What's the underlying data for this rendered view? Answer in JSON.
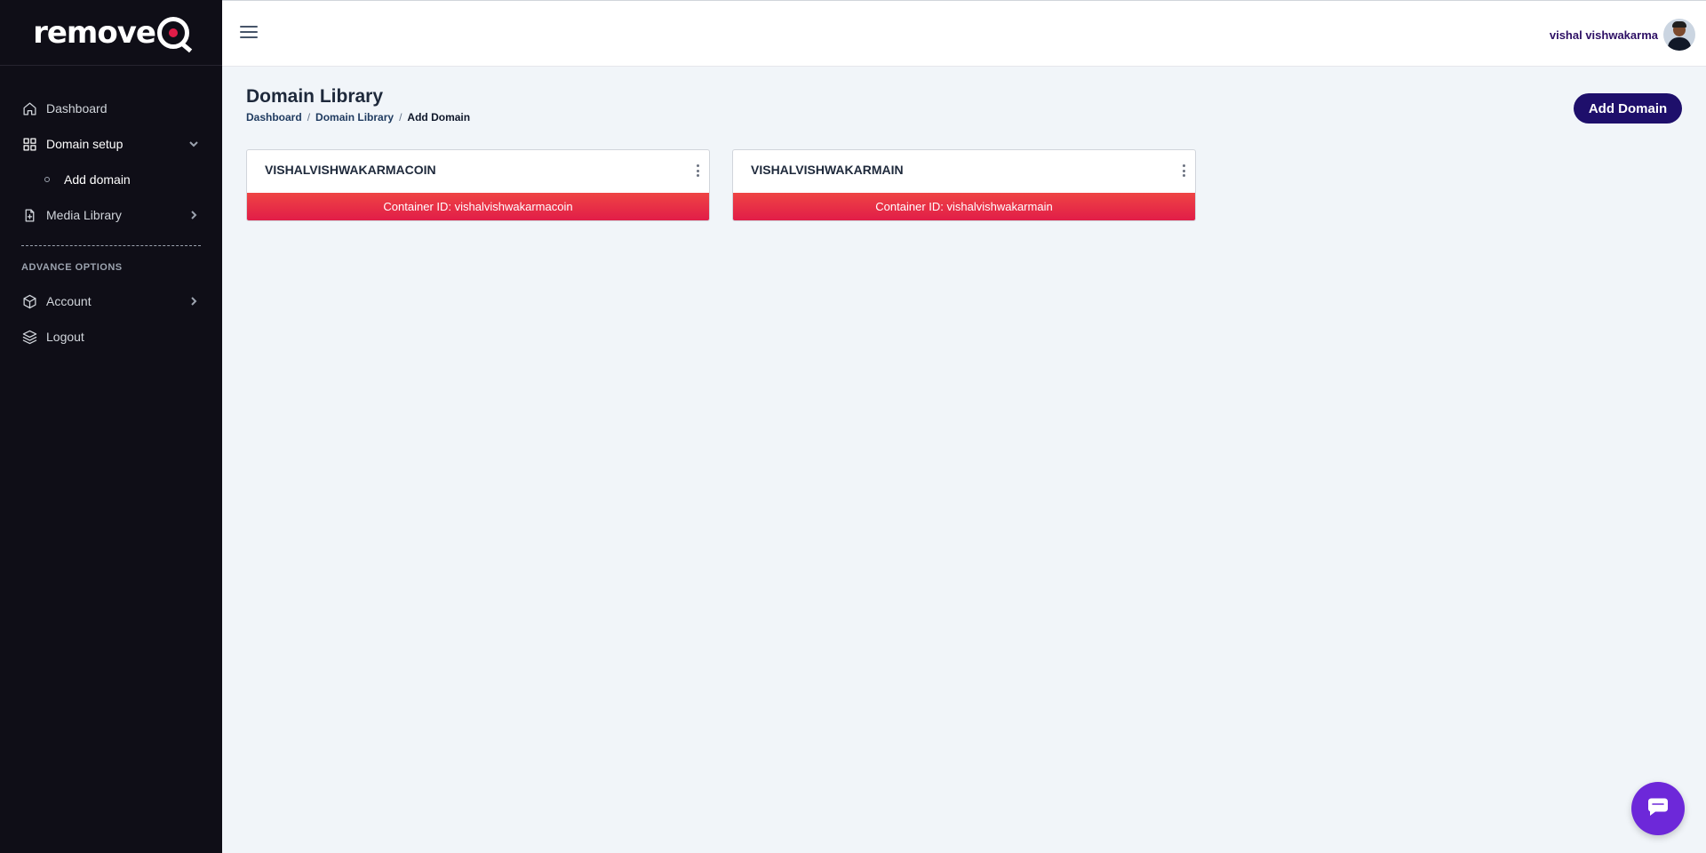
{
  "brand": {
    "logo_text": "remove"
  },
  "sidebar": {
    "items": [
      {
        "label": "Dashboard",
        "icon": "home-icon"
      },
      {
        "label": "Domain setup",
        "icon": "grid-icon",
        "expanded": true,
        "children": [
          {
            "label": "Add domain"
          }
        ]
      },
      {
        "label": "Media Library",
        "icon": "file-add-icon"
      }
    ],
    "section_label": "ADVANCE OPTIONS",
    "advanced": [
      {
        "label": "Account",
        "icon": "box-icon"
      },
      {
        "label": "Logout",
        "icon": "layers-icon"
      }
    ]
  },
  "header": {
    "user_name": "vishal vishwakarma"
  },
  "main": {
    "title": "Domain Library",
    "breadcrumb": [
      "Dashboard",
      "Domain Library",
      "Add Domain"
    ],
    "add_button_label": "Add Domain",
    "cards": [
      {
        "name": "VISHALVISHWAKARMACOIN",
        "container": "Container ID: vishalvishwakarmacoin"
      },
      {
        "name": "VISHALVISHWAKARMAIN",
        "container": "Container ID: vishalvishwakarmain"
      }
    ]
  },
  "colors": {
    "sidebar_bg": "#0f0e17",
    "primary_button": "#1e0f6b",
    "card_footer": "#e11d48",
    "chat_button": "#6d28d9"
  }
}
